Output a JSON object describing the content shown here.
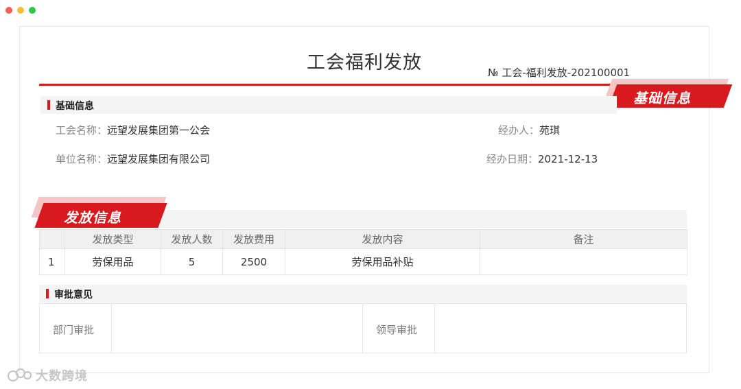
{
  "window": {
    "colors": {
      "close": "#f45c54",
      "minimize": "#f5bd3a",
      "maximize": "#2fc842"
    }
  },
  "doc": {
    "title": "工会福利发放",
    "number": "№  工会-福利发放-202100001",
    "accent_color": "#d8191e"
  },
  "ribbons": {
    "basic": "基础信息",
    "distribution": "发放信息"
  },
  "basic_section": {
    "heading": "基础信息",
    "union_name_label": "工会名称：",
    "union_name_value": "远望发展集团第一公会",
    "handler_label": "经办人：",
    "handler_value": "苑琪",
    "unit_name_label": "单位名称：",
    "unit_name_value": "远望发展集团有限公司",
    "handle_date_label": "经办日期：",
    "handle_date_value": "2021-12-13"
  },
  "distribution_table": {
    "headers": [
      "",
      "发放类型",
      "发放人数",
      "发放费用",
      "发放内容",
      "备注"
    ],
    "rows": [
      [
        "1",
        "劳保用品",
        "5",
        "2500",
        "劳保用品补贴",
        ""
      ]
    ]
  },
  "approval_section": {
    "heading": "审批意见",
    "dept_label": "部门审批",
    "leader_label": "领导审批"
  },
  "watermark": {
    "text": "大数跨境",
    "icon": "cloud-logo-icon"
  }
}
